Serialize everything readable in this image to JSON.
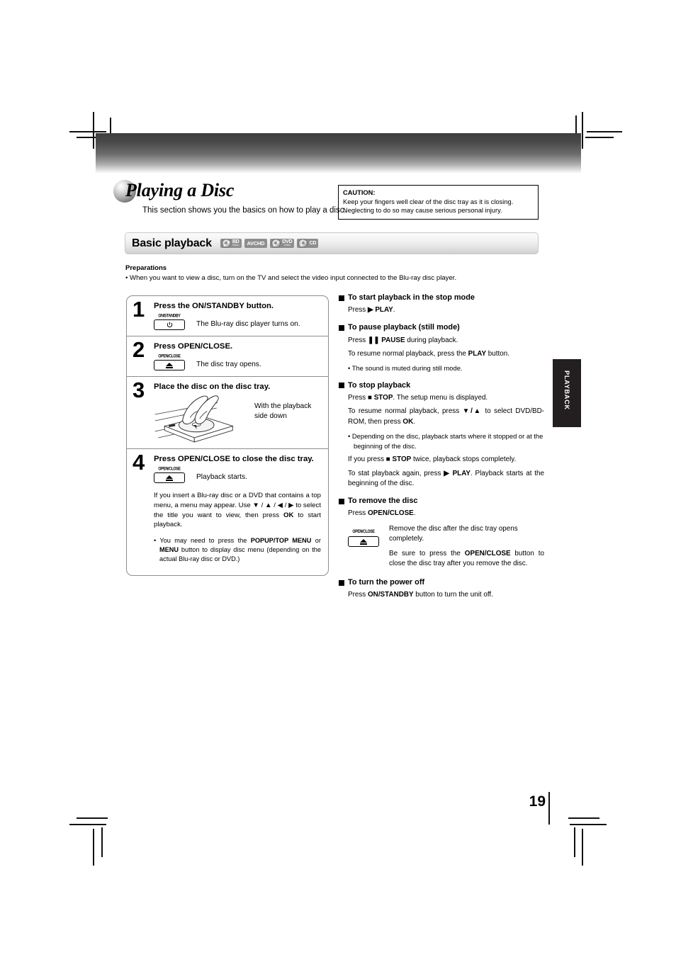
{
  "document": {
    "page_number": "19",
    "side_tab": "PLAYBACK"
  },
  "title": {
    "heading": "Playing a Disc",
    "subheading": "This section shows you the basics on how to play a disc."
  },
  "caution": {
    "label": "CAUTION:",
    "line1": "Keep your fingers well clear of the disc tray as it is closing.",
    "line2": "Neglecting to do so may cause serious personal injury."
  },
  "section": {
    "title": "Basic playback",
    "disc_badges": [
      {
        "id": "bd-video-icon",
        "main": "BD",
        "sub": "Video"
      },
      {
        "id": "avchd-icon",
        "main": "AVCHD",
        "sub": ""
      },
      {
        "id": "dvd-video-icon",
        "main": "DVD",
        "sub": "Video"
      },
      {
        "id": "cd-icon",
        "main": "CD",
        "sub": ""
      }
    ]
  },
  "preparations": {
    "title": "Preparations",
    "text": "• When you want to view a disc, turn on the TV and select the video input connected to the Blu-ray disc player."
  },
  "steps": [
    {
      "number": "1",
      "heading": "Press the ON/STANDBY button.",
      "key_label": "ON/STANDBY",
      "key_glyph": "power",
      "note": "The Blu-ray disc player turns on."
    },
    {
      "number": "2",
      "heading": "Press OPEN/CLOSE.",
      "key_label": "OPEN/CLOSE",
      "key_glyph": "eject",
      "note": "The disc tray opens."
    },
    {
      "number": "3",
      "heading": "Place the disc on the disc tray.",
      "note": "With the playback side down"
    },
    {
      "number": "4",
      "heading": "Press OPEN/CLOSE to close the disc tray.",
      "key_label": "OPEN/CLOSE",
      "key_glyph": "eject",
      "note": "Playback starts.",
      "extra_paragraph_parts": {
        "p1a": "If you insert a Blu-ray disc or a DVD that contains a top menu, a menu may appear. Use ",
        "p1_arrows": "▼ / ▲ / ◀ / ▶",
        "p1b": " to select the title you want to view, then press ",
        "p1_ok": "OK",
        "p1c": " to start playback."
      },
      "bullet_parts": {
        "b1a": "• You may need to press the ",
        "b1_popup": "POPUP/TOP MENU",
        "b1b": " or ",
        "b1_menu": "MENU",
        "b1c": " button to display disc menu (depending on the actual Blu-ray disc or DVD.)"
      }
    }
  ],
  "right_sections": [
    {
      "heading": "To start playback in the stop mode",
      "lines": {
        "l1a": "Press ",
        "l1_play": "▶ PLAY",
        "l1b": "."
      }
    },
    {
      "heading": "To pause playback (still mode)",
      "lines": {
        "l1a": "Press ",
        "l1_pause": "❚❚ PAUSE",
        "l1b": " during playback.",
        "l2a": "To resume normal playback, press the ",
        "l2_play": "PLAY",
        "l2b": " button.",
        "bullet": "• The sound is muted during still mode."
      }
    },
    {
      "heading": "To stop playback",
      "lines": {
        "l1a": "Press ",
        "l1_stop": "■ STOP",
        "l1b": ". The setup menu is displayed.",
        "l2a": "To resume normal playback, press ",
        "l2_arrows": "▼/▲",
        "l2b": " to select DVD/BD-ROM, then press ",
        "l2_ok": "OK",
        "l2c": ".",
        "bullet": "• Depending on the disc, playback starts where it stopped or at the beginning of the disc.",
        "l3a": "If you press ",
        "l3_stop": "■ STOP",
        "l3b": " twice, playback stops completely.",
        "l4a": "To stat playback again, press ",
        "l4_play": "▶ PLAY",
        "l4b": ". Playback starts at the beginning of the disc."
      }
    },
    {
      "heading": "To remove the disc",
      "lines": {
        "l1a": "Press ",
        "l1_oc": "OPEN/CLOSE",
        "l1b": ".",
        "key_label": "OPEN/CLOSE",
        "r1": "Remove the disc after the disc tray opens completely.",
        "r2a": "Be sure to press the ",
        "r2_oc": "OPEN/CLOSE",
        "r2b": " button to close the disc tray after you remove the disc."
      }
    },
    {
      "heading": "To turn the power off",
      "lines": {
        "l1a": "Press ",
        "l1_os": "ON/STANDBY",
        "l1b": " button to turn the unit off."
      }
    }
  ],
  "colors": {
    "ink": "#000000",
    "tab_background": "#231f20",
    "rule": "#8d8d8d"
  }
}
